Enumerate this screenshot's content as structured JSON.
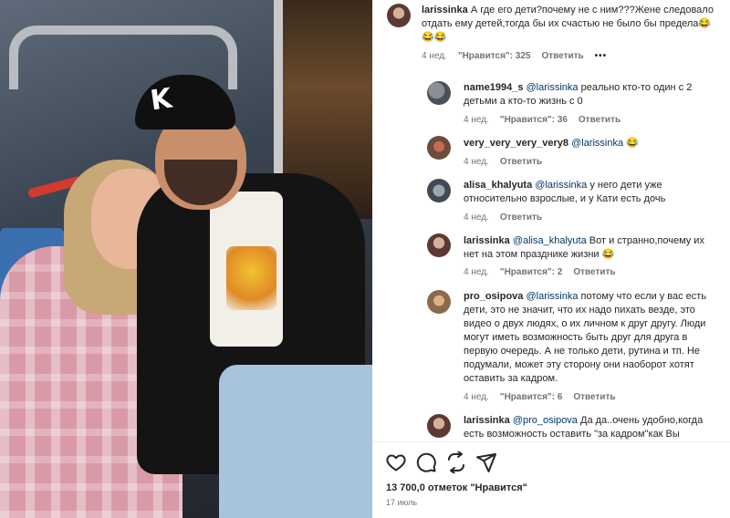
{
  "post": {
    "likes_text": "13 700,0 отметок \"Нравится\"",
    "date": "17 июль",
    "photo_cap_logo": "K"
  },
  "comments": [
    {
      "user": "larissinka",
      "mention": "",
      "text": "А где его дети?почему не с ним???Жене следовало отдать ему детей,тогда бы их счастью не было бы предела😂😂😂",
      "time": "4 нед.",
      "likes": "\"Нравится\": 325",
      "reply": "Ответить",
      "more": "•••"
    },
    {
      "user": "name1994_s",
      "mention": "@larissinka",
      "text": "реально кто-то один с 2 детьми а кто-то жизнь с 0",
      "time": "4 нед.",
      "likes": "\"Нравится\": 36",
      "reply": "Ответить"
    },
    {
      "user": "very_very_very_very8",
      "mention": "@larissinka",
      "text": "😂",
      "time": "4 нед.",
      "likes": "",
      "reply": "Ответить"
    },
    {
      "user": "alisa_khalyuta",
      "mention": "@larissinka",
      "text": "у него дети уже относительно взрослые, и у Кати есть дочь",
      "time": "4 нед.",
      "likes": "",
      "reply": "Ответить"
    },
    {
      "user": "larissinka",
      "mention": "@alisa_khalyuta",
      "text": "Вот и странно,почему их нет на этом празднике жизни 😂",
      "time": "4 нед.",
      "likes": "\"Нравится\": 2",
      "reply": "Ответить"
    },
    {
      "user": "pro_osipova",
      "mention": "@larissinka",
      "text": "потому что если у вас есть дети, это не значит, что их надо пихать везде, это видео о двух людях, о их личном к друг другу. Люди могут иметь возможность быть друг для друга в первую очередь. А не только дети, рутина и тп. Не подумали, может эту сторону они наоборот хотят оставить за кадром.",
      "time": "4 нед.",
      "likes": "\"Нравится\": 6",
      "reply": "Ответить"
    },
    {
      "user": "larissinka",
      "mention": "@pro_osipova",
      "text": "Да да..очень удобно,когда есть возможность оставить \"за кадром\"как Вы",
      "time": "",
      "likes": "",
      "reply": ""
    }
  ],
  "icons": [
    "heart-icon",
    "comment-icon",
    "share-icon",
    "send-icon"
  ]
}
